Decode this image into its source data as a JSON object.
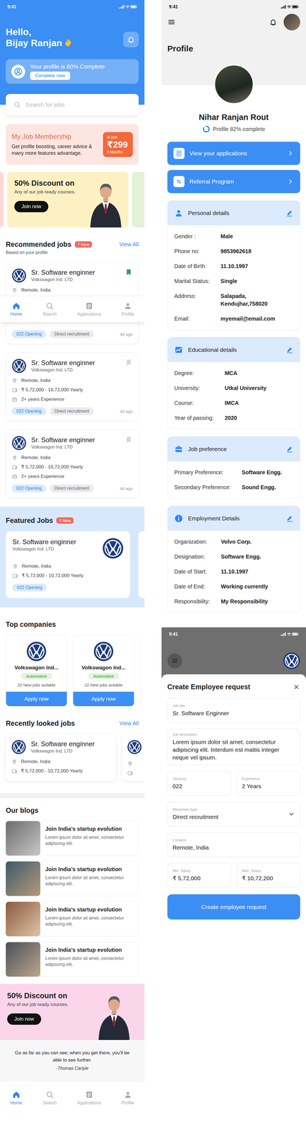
{
  "home": {
    "status_time": "9:41",
    "greeting": "Hello,",
    "user_name": "Bijay Ranjan",
    "profile_prompt": {
      "text": "Your profile is 60% Complete",
      "button": "Complete now"
    },
    "search": {
      "placeholder": "Search for jobs"
    },
    "membership": {
      "title": "My Job Membership",
      "text": "Get profile boosting, career advice & many more features advantage.",
      "price_label": "at just",
      "price": "₹299",
      "period": "3 Months"
    },
    "promo": {
      "title": "50% Discount on",
      "subtitle": "Any of our job ready courses.",
      "button": "Join now"
    },
    "recommended": {
      "title": "Recommended jobs",
      "badge": "7 New",
      "view_all": "View All",
      "subtitle": "Based on your profile",
      "jobs": [
        {
          "kind": "partial",
          "title": "Sr. Software enginner",
          "company": "Volkswagon Ind. LTD",
          "location": "Remote, India",
          "opening": "022 Opening",
          "type": "Direct recruitment",
          "posted": "4d ago",
          "saved": true
        },
        {
          "kind": "full",
          "title": "Sr. Software enginner",
          "company": "Volkswagon Ind. LTD",
          "location": "Remote, India",
          "salary": "₹ 5,72,000 - 10,72,000 Yearly",
          "experience": "2+ years Experience",
          "opening": "022 Opening",
          "type": "Direct recruitment",
          "posted": "4d ago",
          "saved": false
        },
        {
          "kind": "full",
          "title": "Sr. Software enginner",
          "company": "Volkswagon Ind. LTD",
          "location": "Remote, India",
          "salary": "₹ 5,72,000 - 10,72,000 Yearly",
          "experience": "2+ years Experience",
          "opening": "022 Opening",
          "type": "Direct recruitment",
          "posted": "4d ago",
          "saved": false
        }
      ]
    },
    "floating_nav": [
      {
        "label": "Home",
        "selected": true
      },
      {
        "label": "Search",
        "selected": false
      },
      {
        "label": "Applications",
        "selected": false
      },
      {
        "label": "Profile",
        "selected": false
      }
    ],
    "featured": {
      "title": "Featured Jobs",
      "badge": "7 New",
      "jobs": [
        {
          "title": "Sr. Software enginner",
          "company": "Volkswagon Ind. LTD",
          "location": "Remote, India",
          "salary": "₹ 5,72,000 - 10,72,000 Yearly",
          "opening": "022 Opening"
        }
      ]
    },
    "companies": {
      "title": "Top companies",
      "items": [
        {
          "name": "Volkswagon Ind...",
          "category": "Automotive",
          "jobs": "22 New jobs avilable",
          "button": "Apply now"
        },
        {
          "name": "Volkswagon Ind...",
          "category": "Automotive",
          "jobs": "22 New jobs avilable",
          "button": "Apply now"
        }
      ]
    },
    "recent": {
      "title": "Recently looked jobs",
      "view_all": "View All",
      "jobs": [
        {
          "title": "Sr. Software enginner",
          "company": "Volkswagon Ind. LTD",
          "location": "Remote, India",
          "salary": "₹ 5,72,000 - 10,72,000 Yearly"
        }
      ]
    },
    "blogs": {
      "title": "Our blogs",
      "posts": [
        {
          "title": "Join India’s startup evolution",
          "text": "Lorem ipsum dolor sit amet, consectetur adipiscing elit."
        },
        {
          "title": "Join India’s startup evolution",
          "text": "Lorem ipsum dolor sit amet, consectetur adipiscing elit."
        },
        {
          "title": "Join India’s startup evolution",
          "text": "Lorem ipsum dolor sit amet, consectetur adipiscing elit."
        },
        {
          "title": "Join India’s startup evolution",
          "text": "Lorem ipsum dolor sit amet, consectetur adipiscing elit."
        }
      ]
    },
    "promo_bottom": {
      "title": "50% Discount on",
      "subtitle": "Any of our job ready courses.",
      "button": "Join now"
    },
    "quote": {
      "text": "Go as far as you can see; when you get there, you’ll be able to see further.",
      "author": "-Thomas Carlyle"
    },
    "bottom_nav": [
      {
        "label": "Home",
        "selected": true
      },
      {
        "label": "Search",
        "selected": false
      },
      {
        "label": "Applications",
        "selected": false
      },
      {
        "label": "Profile",
        "selected": false
      }
    ]
  },
  "profile": {
    "status_time": "9:41",
    "title": "Profile",
    "name": "Nihar Ranjan Rout",
    "progress": {
      "text": "Profile 82% complete",
      "level": 0.82
    },
    "actions": [
      "View your applications",
      "Referral Program"
    ],
    "sections": [
      {
        "title": "Personal details",
        "rows": [
          {
            "label": "Gender :",
            "value": "Male"
          },
          {
            "label": "Phone no:",
            "value": "9853962618"
          },
          {
            "label": "Date of Birth:",
            "value": "11.10.1997"
          },
          {
            "label": "Marital Status:",
            "value": "Single"
          },
          {
            "label": "Address:",
            "value": "Salapada, Kendujhar,758020"
          },
          {
            "label": "Email:",
            "value": "myemail@email.com"
          }
        ]
      },
      {
        "title": "Educational details",
        "rows": [
          {
            "label": "Degree:",
            "value": "MCA"
          },
          {
            "label": "University:",
            "value": "Utkal University"
          },
          {
            "label": "Course:",
            "value": "IMCA"
          },
          {
            "label": "Year of passing:",
            "value": "2020"
          }
        ]
      },
      {
        "title": "Job preference",
        "rows": [
          {
            "label": "Primary Preference:",
            "value": "Software Engg."
          },
          {
            "label": "Secondary Preference:",
            "value": "Sound Engg."
          }
        ]
      },
      {
        "title": "Employment Details",
        "rows": [
          {
            "label": "Organization:",
            "value": "Volvo Corp."
          },
          {
            "label": "Designation:",
            "value": "Software Engg."
          },
          {
            "label": "Date of Start:",
            "value": "11.10.1997"
          },
          {
            "label": "Date of End:",
            "value": "Working currently"
          },
          {
            "label": "Responsibility:",
            "value": "My Responsibility"
          }
        ]
      }
    ]
  },
  "create_request": {
    "status_time": "9:41",
    "title": "Create Employee request",
    "close": "×",
    "rows": [
      [
        {
          "kind": "input",
          "label": "Job title",
          "value": "Sr. Software Enginner"
        }
      ],
      [
        {
          "kind": "textarea",
          "label": "Job description",
          "value": "Lorem ipsum dolor sit amet, consectetur adipiscing elit. Interdum est mattis integer neque vel ipsum."
        }
      ],
      [
        {
          "kind": "input",
          "label": "Vacancy",
          "value": "022"
        },
        {
          "kind": "input",
          "label": "Experience",
          "value": "2 Years"
        }
      ],
      [
        {
          "kind": "select",
          "label": "Manpower type",
          "value": "Direct recruitment"
        }
      ],
      [
        {
          "kind": "input",
          "label": "Location",
          "value": "Remote, India"
        }
      ],
      [
        {
          "kind": "input",
          "label": "Min. Salary",
          "value": "₹ 5,72,000"
        },
        {
          "kind": "input",
          "label": "Max. Salary",
          "value": "₹ 10,72,200"
        }
      ]
    ],
    "button": "Create employee request"
  }
}
